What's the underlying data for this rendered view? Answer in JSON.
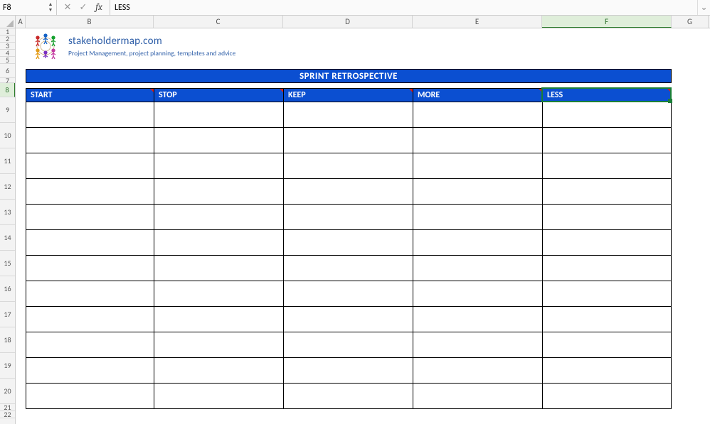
{
  "formula_bar": {
    "cell_ref": "F8",
    "cancel_glyph": "✕",
    "confirm_glyph": "✓",
    "fx_label": "fx",
    "formula_value": "LESS"
  },
  "columns": [
    "A",
    "B",
    "C",
    "D",
    "E",
    "F",
    "G"
  ],
  "active_cell": "F8",
  "rows_visible": [
    "1",
    "2",
    "3",
    "4",
    "5",
    "6",
    "7",
    "8",
    "9",
    "10",
    "11",
    "12",
    "13",
    "14",
    "15",
    "16",
    "17",
    "18",
    "19",
    "20",
    "21",
    "22"
  ],
  "brand": {
    "title": "stakeholdermap.com",
    "subtitle": "Project Management, project planning, templates and advice"
  },
  "sheet": {
    "title": "SPRINT RETROSPECTIVE",
    "headers": [
      "START",
      "STOP",
      "KEEP",
      "MORE",
      "LESS"
    ],
    "data_row_count": 12
  },
  "colors": {
    "header_blue": "#0b4fd1",
    "brand_blue": "#2f5fa8",
    "selection_green": "#1a7f37"
  }
}
